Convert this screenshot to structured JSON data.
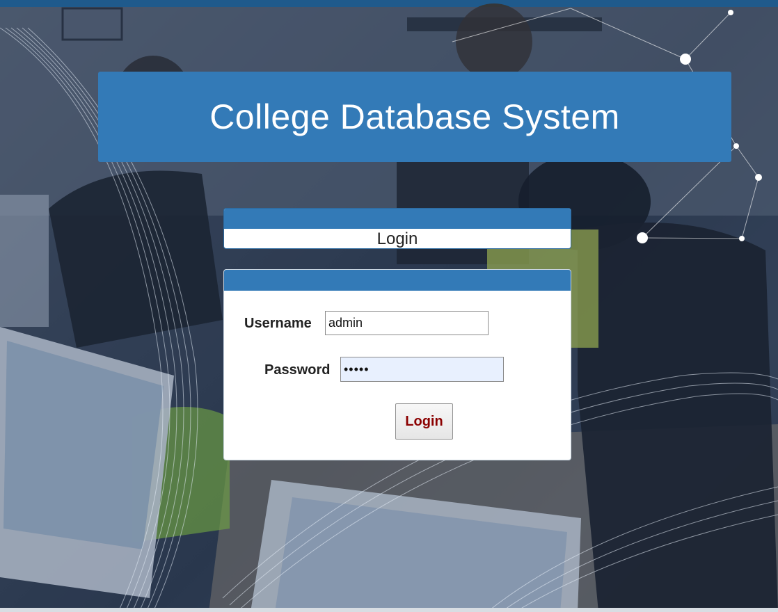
{
  "app": {
    "title": "College Database System"
  },
  "login_header": {
    "label": "Login"
  },
  "form": {
    "username_label": "Username",
    "username_value": "admin",
    "password_label": "Password",
    "password_value": "admin",
    "submit_label": "Login"
  },
  "colors": {
    "accent": "#337ab7",
    "button_text": "#8b0000",
    "top_strip": "#1f5a8c",
    "autofill_bg": "#e8f0fe"
  }
}
